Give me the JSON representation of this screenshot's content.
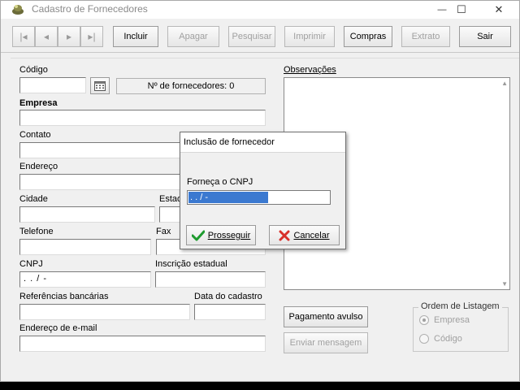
{
  "window": {
    "title": "Cadastro de Fornecedores",
    "controls": {
      "minimize": "—",
      "maximize": "☐",
      "close": "✕"
    }
  },
  "toolbar": {
    "nav": [
      "|◂",
      "◂",
      "▸",
      "▸|"
    ],
    "incluir": {
      "label": "Incluir",
      "accesskey": "I"
    },
    "apagar": {
      "label": "Apagar",
      "accesskey": "A"
    },
    "pesquisar": {
      "label": "Pesquisar",
      "accesskey": "P"
    },
    "imprimir": {
      "label": "Imprimir",
      "accesskey": "m"
    },
    "compras": {
      "label": "Compras",
      "accesskey": "C"
    },
    "extrato": {
      "label": "Extrato",
      "accesskey": "x"
    },
    "sair": {
      "label": "Sair",
      "accesskey": "S"
    }
  },
  "form": {
    "codigo": {
      "label": "Código",
      "value": ""
    },
    "contador": "Nº de fornecedores: 0",
    "empresa": {
      "label": "Empresa",
      "value": ""
    },
    "contato": {
      "label": "Contato",
      "value": ""
    },
    "endereco": {
      "label": "Endereço",
      "value": ""
    },
    "cidade": {
      "label": "Cidade",
      "value": ""
    },
    "estado": {
      "label": "Estad",
      "value": ""
    },
    "telefone": {
      "label": "Telefone",
      "value": ""
    },
    "fax": {
      "label": "Fax",
      "value": ""
    },
    "cnpj": {
      "label": "CNPJ",
      "value": " .  .  /  -"
    },
    "inscricao": {
      "label": "Inscrição estadual",
      "value": ""
    },
    "referencias": {
      "label": "Referências bancárias",
      "value": ""
    },
    "data_cadastro": {
      "label": "Data do cadastro",
      "value": ""
    },
    "email": {
      "label": "Endereço de e-mail",
      "value": ""
    },
    "observacoes": {
      "label": "Observações",
      "value": ""
    }
  },
  "actions": {
    "pagamento": "Pagamento avulso",
    "enviar": "Enviar mensagem"
  },
  "ordem": {
    "title": "Ordem de Listagem",
    "options": [
      "Empresa",
      "Código"
    ],
    "selected": "Empresa"
  },
  "dialog": {
    "title": "Inclusão de fornecedor",
    "prompt": "Forneça o CNPJ",
    "value": " .  .  /  -",
    "ok": "Prosseguir",
    "cancel": "Cancelar"
  }
}
